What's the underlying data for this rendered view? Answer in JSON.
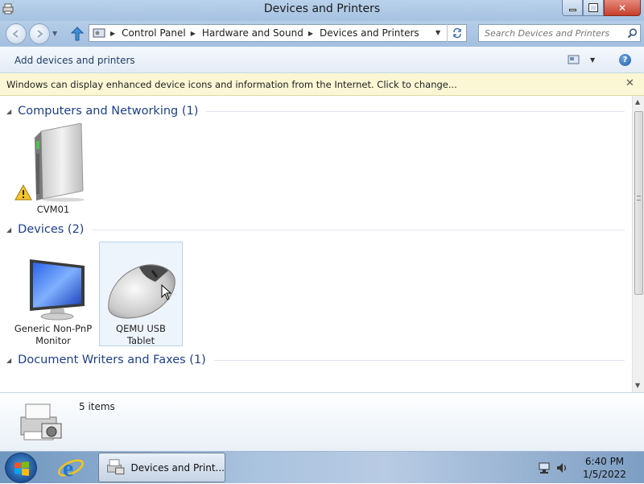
{
  "window": {
    "title": "Devices and Printers",
    "buttons": {
      "minimize": "—",
      "maximize": "□",
      "close": "✕"
    }
  },
  "nav": {
    "breadcrumb": [
      "Control Panel",
      "Hardware and Sound",
      "Devices and Printers"
    ],
    "search_placeholder": "Search Devices and Printers"
  },
  "command_bar": {
    "add_label": "Add devices and printers"
  },
  "info_bar": {
    "message": "Windows can display enhanced device icons and information from the Internet. Click to change...",
    "close": "✕"
  },
  "groups": [
    {
      "name": "Computers and Networking (1)",
      "devices": [
        {
          "label": "CVM01",
          "icon": "computer-tower-icon",
          "warning": true
        }
      ]
    },
    {
      "name": "Devices (2)",
      "devices": [
        {
          "label": "Generic Non-PnP Monitor",
          "icon": "monitor-icon"
        },
        {
          "label": "QEMU USB Tablet",
          "icon": "mouse-icon",
          "selected": true
        }
      ]
    },
    {
      "name": "Document Writers and Faxes (1)",
      "devices": []
    }
  ],
  "details": {
    "count": "5 items"
  },
  "taskbar": {
    "active_window": "Devices and Print...",
    "time": "6:40 PM",
    "date": "1/5/2022"
  }
}
